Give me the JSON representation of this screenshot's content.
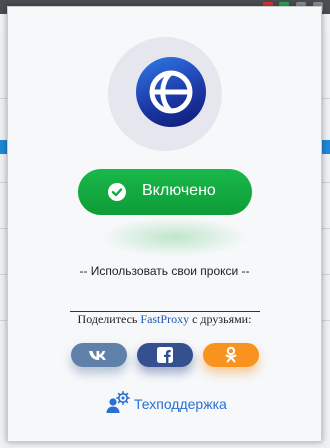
{
  "popup": {
    "status_button": {
      "label": "Включено",
      "state": "on",
      "color": "#14aa41"
    },
    "own_proxy_link": "-- Использовать свои прокси --",
    "share": {
      "prefix": "Поделитесь",
      "brand": "FastProxy",
      "suffix": "с друзьями:",
      "networks": [
        {
          "name": "vk",
          "icon": "vk-icon",
          "color": "#5f80a8"
        },
        {
          "name": "facebook",
          "icon": "facebook-icon",
          "color": "#34508f"
        },
        {
          "name": "odnoklassniki",
          "icon": "odnoklassniki-icon",
          "color": "#f7931e"
        }
      ]
    },
    "support": {
      "label": "Техподдержка",
      "icon": "support-user-gear-icon"
    },
    "logo": {
      "icon": "globe-icon"
    }
  },
  "colors": {
    "brand_blue": "#1d3aa8",
    "link_blue": "#2a6fd1",
    "popup_background": "#f7f8fa"
  }
}
